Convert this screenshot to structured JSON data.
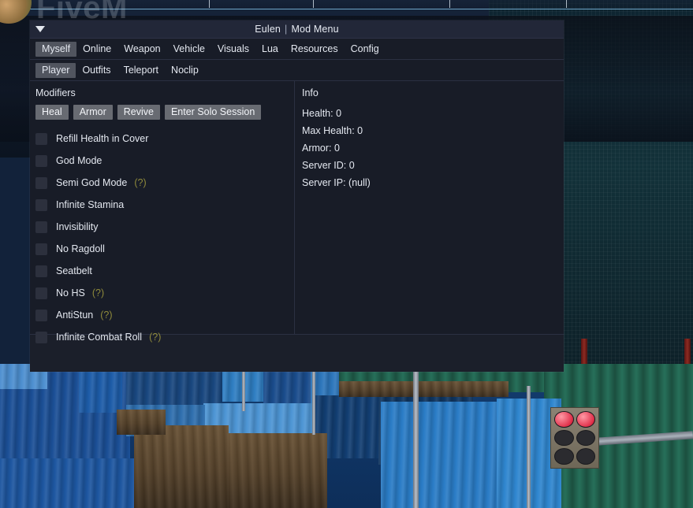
{
  "overlay": {
    "watermark": "FiveM"
  },
  "window": {
    "title_left": "Eulen",
    "title_sep": "|",
    "title_right": "Mod Menu",
    "collapse_icon": "triangle-down-icon"
  },
  "main_tabs": [
    {
      "label": "Myself",
      "active": true
    },
    {
      "label": "Online",
      "active": false
    },
    {
      "label": "Weapon",
      "active": false
    },
    {
      "label": "Vehicle",
      "active": false
    },
    {
      "label": "Visuals",
      "active": false
    },
    {
      "label": "Lua",
      "active": false
    },
    {
      "label": "Resources",
      "active": false
    },
    {
      "label": "Config",
      "active": false
    }
  ],
  "sub_tabs": [
    {
      "label": "Player",
      "active": true
    },
    {
      "label": "Outfits",
      "active": false
    },
    {
      "label": "Teleport",
      "active": false
    },
    {
      "label": "Noclip",
      "active": false
    }
  ],
  "modifiers": {
    "title": "Modifiers",
    "buttons": [
      {
        "label": "Heal"
      },
      {
        "label": "Armor"
      },
      {
        "label": "Revive"
      },
      {
        "label": "Enter Solo Session"
      }
    ],
    "toggles": [
      {
        "label": "Refill Health in Cover",
        "checked": false,
        "help": ""
      },
      {
        "label": "God Mode",
        "checked": false,
        "help": ""
      },
      {
        "label": "Semi God Mode",
        "checked": false,
        "help": "(?)"
      },
      {
        "label": "Infinite Stamina",
        "checked": false,
        "help": ""
      },
      {
        "label": "Invisibility",
        "checked": false,
        "help": ""
      },
      {
        "label": "No Ragdoll",
        "checked": false,
        "help": ""
      },
      {
        "label": "Seatbelt",
        "checked": false,
        "help": ""
      },
      {
        "label": "No HS",
        "checked": false,
        "help": "(?)"
      },
      {
        "label": "AntiStun",
        "checked": false,
        "help": "(?)"
      },
      {
        "label": "Infinite Combat Roll",
        "checked": false,
        "help": "(?)"
      }
    ]
  },
  "info": {
    "title": "Info",
    "rows": [
      "Health: 0",
      "Max Health: 0",
      "Armor: 0",
      "Server ID: 0",
      "Server IP: (null)"
    ]
  },
  "colors": {
    "window_bg": "#1b1f2a",
    "content_bg": "#181c27",
    "titlebar_bg": "#222738",
    "text": "#e4e8f0",
    "active_tab_bg": "#51555f",
    "button_bg": "#686b72",
    "checkbox_bg": "#2c303d",
    "help_yellow": "#8f8a3b",
    "border": "#2b3042"
  }
}
